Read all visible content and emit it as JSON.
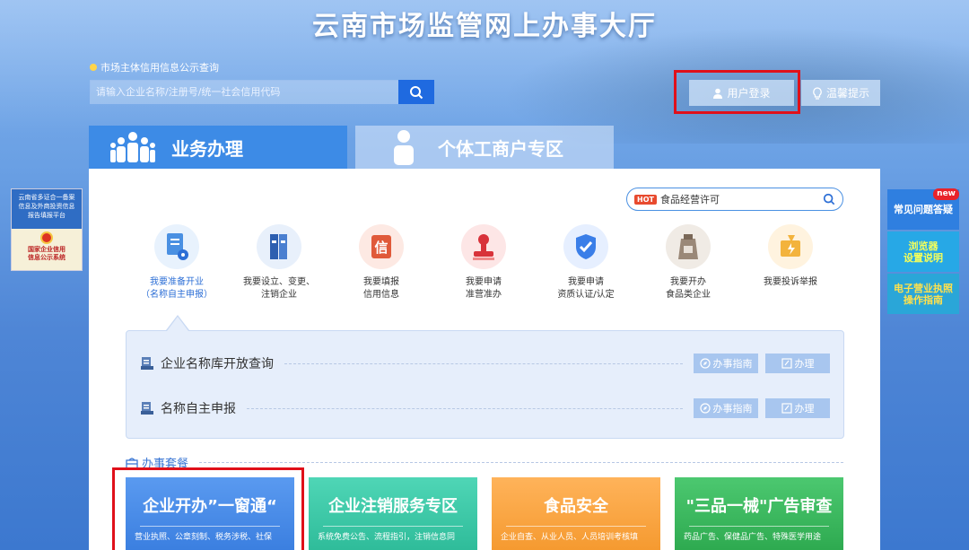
{
  "header": {
    "title": "云南市场监管网上办事大厅",
    "credit_label": "市场主体信用信息公示查询",
    "search_placeholder": "请输入企业名称/注册号/统一社会信用代码",
    "login_label": "用户登录",
    "tips_label": "温馨提示"
  },
  "tabs": [
    {
      "label": "业务办理",
      "active": true
    },
    {
      "label": "个体工商户专区",
      "active": false
    }
  ],
  "food_search": {
    "hot": "HOT",
    "value": "食品经营许可"
  },
  "services": [
    {
      "label": "我要准备开业\n（名称自主申报）",
      "icon": "document-gear-icon",
      "color": "#e8f2fd"
    },
    {
      "label": "我要设立、变更、\n注销企业",
      "icon": "binder-icon",
      "color": "#e8f0fb"
    },
    {
      "label": "我要填报\n信用信息",
      "icon": "credit-seal-icon",
      "color": "#fde9e3"
    },
    {
      "label": "我要申请\n准营准办",
      "icon": "stamp-icon",
      "color": "#fde6e6"
    },
    {
      "label": "我要申请\n资质认证/认定",
      "icon": "shield-check-icon",
      "color": "#e6efff"
    },
    {
      "label": "我要开办\n食品类企业",
      "icon": "food-bag-icon",
      "color": "#f0ebe5"
    },
    {
      "label": "我要投诉举报",
      "icon": "complaint-icon",
      "color": "#fff3df"
    }
  ],
  "sub_rows": [
    {
      "title": "企业名称库开放查询",
      "guide": "办事指南",
      "do": "办理"
    },
    {
      "title": "名称自主申报",
      "guide": "办事指南",
      "do": "办理"
    }
  ],
  "package": {
    "title": "办事套餐"
  },
  "cards": [
    {
      "title": "企业开办”一窗通“",
      "desc": "营业执照、公章刻制、税务涉税、社保"
    },
    {
      "title": "企业注销服务专区",
      "desc": "系统免费公告、流程指引，注销信息同"
    },
    {
      "title": "食品安全",
      "desc": "企业自查、从业人员、人员培训考核填"
    },
    {
      "title": "\"三品一械\"广告审查",
      "desc": "药品广告、保健品广告、特殊医学用途"
    }
  ],
  "left_ad": {
    "top": "云南省多证合一备案\n信息及外商投资信息\n报告填报平台",
    "bottom": "国家企业信用\n信息公示系统"
  },
  "right_side": [
    {
      "label": "常见问题答疑",
      "badge": "new"
    },
    {
      "label": "浏览器\n设置说明"
    },
    {
      "label": "电子营业执照\n操作指南"
    }
  ],
  "colors": {
    "accent": "#3d8be6",
    "highlight": "#e0101a"
  }
}
